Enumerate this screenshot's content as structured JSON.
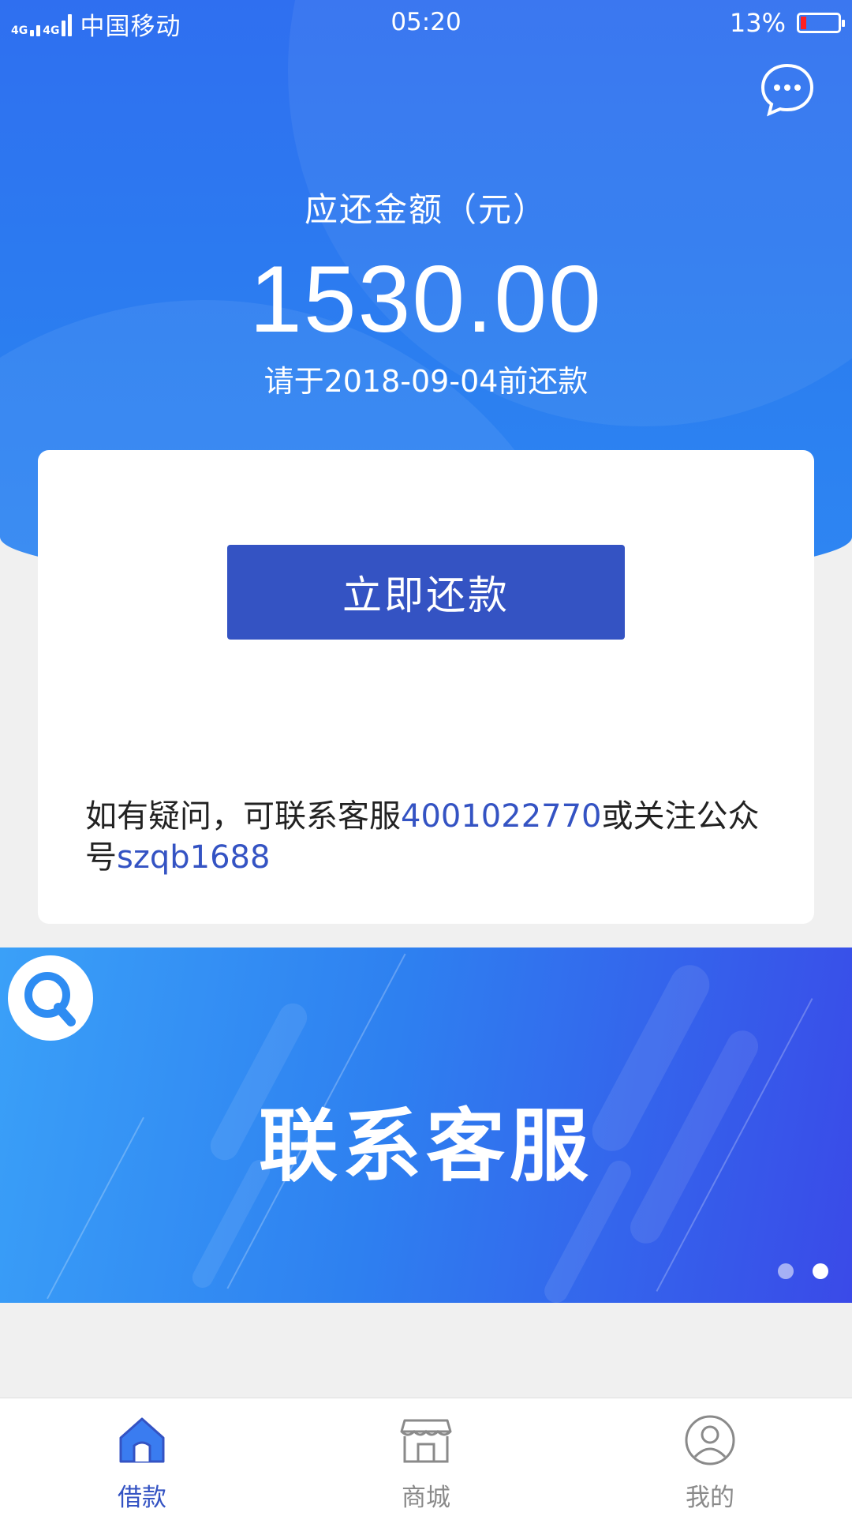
{
  "status_bar": {
    "network": "4G",
    "carrier": "中国移动",
    "time": "05:20",
    "battery": "13%"
  },
  "header": {
    "amount_label": "应还金额（元）",
    "amount": "1530.00",
    "due_text": "请于2018-09-04前还款"
  },
  "card": {
    "pay_button": "立即还款",
    "contact_prefix": "如有疑问，可联系客服",
    "phone": "4001022770",
    "contact_middle": "或关注公众号",
    "wechat": "szqb1688"
  },
  "banner": {
    "title": "联系客服"
  },
  "tabs": [
    {
      "label": "借款",
      "icon": "home-icon",
      "active": true
    },
    {
      "label": "商城",
      "icon": "store-icon",
      "active": false
    },
    {
      "label": "我的",
      "icon": "profile-icon",
      "active": false
    }
  ],
  "colors": {
    "primary": "#3453c3",
    "header_blue": "#2b7ef0",
    "tab_inactive": "#8a8a8a"
  }
}
